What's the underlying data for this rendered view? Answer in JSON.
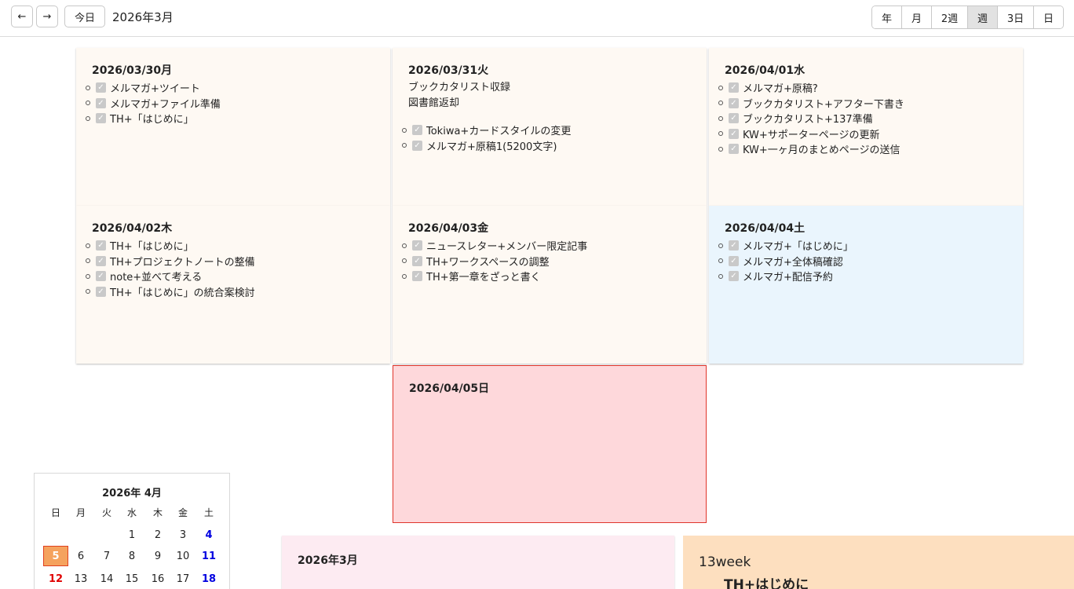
{
  "toolbar": {
    "prev_icon": "←",
    "next_icon": "→",
    "today_label": "今日",
    "title": "2026年3月",
    "views": [
      {
        "label": "年",
        "active": false
      },
      {
        "label": "月",
        "active": false
      },
      {
        "label": "2週",
        "active": false
      },
      {
        "label": "週",
        "active": true
      },
      {
        "label": "3日",
        "active": false
      },
      {
        "label": "日",
        "active": false
      }
    ]
  },
  "days": [
    {
      "date": "2026/03/30月",
      "kind": "weekday",
      "notes": [],
      "tasks": [
        "メルマガ+ツイート",
        "メルマガ+ファイル準備",
        "TH+「はじめに」"
      ]
    },
    {
      "date": "2026/03/31火",
      "kind": "weekday",
      "notes": [
        "ブックカタリスト収録",
        "図書館返却"
      ],
      "tasks": [
        "Tokiwa+カードスタイルの変更",
        "メルマガ+原稿1(5200文字)"
      ]
    },
    {
      "date": "2026/04/01水",
      "kind": "weekday",
      "notes": [],
      "tasks": [
        "メルマガ+原稿?",
        "ブックカタリスト+アフター下書き",
        "ブックカタリスト+137準備",
        "KW+サポーターページの更新",
        "KW+一ヶ月のまとめページの送信"
      ]
    },
    {
      "date": "2026/04/02木",
      "kind": "weekday",
      "notes": [],
      "tasks": [
        "TH+「はじめに」",
        "TH+プロジェクトノートの整備",
        "note+並べて考える",
        "TH+「はじめに」の統合案検討"
      ]
    },
    {
      "date": "2026/04/03金",
      "kind": "weekday",
      "notes": [],
      "tasks": [
        "ニュースレター+メンバー限定記事",
        "TH+ワークスペースの調整",
        "TH+第一章をざっと書く"
      ]
    },
    {
      "date": "2026/04/04土",
      "kind": "sat",
      "notes": [],
      "tasks": [
        "メルマガ+「はじめに」",
        "メルマガ+全体稿確認",
        "メルマガ+配信予約"
      ]
    },
    {
      "date": "2026/04/05日",
      "kind": "today",
      "notes": [],
      "tasks": []
    }
  ],
  "mini_calendar": {
    "title": "2026年 4月",
    "weekdays": [
      "日",
      "月",
      "火",
      "水",
      "木",
      "金",
      "土"
    ],
    "weeks": [
      [
        "",
        "",
        "",
        "1",
        "2",
        "3",
        "4"
      ],
      [
        "5",
        "6",
        "7",
        "8",
        "9",
        "10",
        "11"
      ],
      [
        "12",
        "13",
        "14",
        "15",
        "16",
        "17",
        "18"
      ]
    ],
    "today": "5"
  },
  "month_panel": {
    "title": "2026年3月"
  },
  "week_panel": {
    "label": "13week",
    "heading": "TH+はじめに"
  },
  "colors": {
    "weekday_card": "#fef9f3",
    "saturday_card": "#eaf5fd",
    "today_card": "#fed8db",
    "today_border": "#e0352b",
    "month_panel": "#fdebf2",
    "week_panel": "#fddfbf",
    "sunday_text": "#e00000",
    "saturday_text": "#0000e0"
  }
}
